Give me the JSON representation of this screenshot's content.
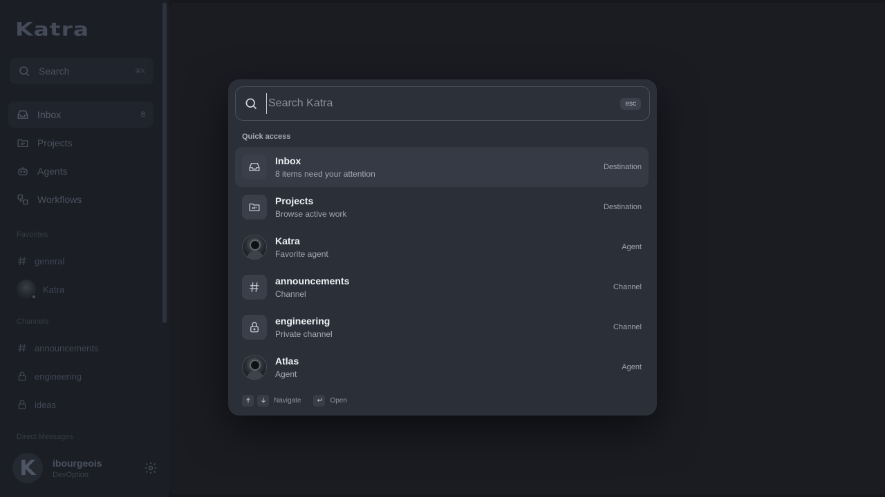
{
  "sidebar": {
    "logo": "Katra",
    "search": {
      "label": "Search",
      "shortcut": "⌘K"
    },
    "nav": [
      {
        "label": "Inbox",
        "icon": "inbox-icon",
        "badge": "8",
        "active": true
      },
      {
        "label": "Projects",
        "icon": "projects-icon"
      },
      {
        "label": "Agents",
        "icon": "agents-icon"
      },
      {
        "label": "Workflows",
        "icon": "workflows-icon"
      }
    ],
    "favorites_title": "Favorites",
    "favorites": [
      {
        "label": "general",
        "icon": "hash-icon"
      },
      {
        "label": "Katra",
        "icon": "avatar"
      }
    ],
    "channels_title": "Channels",
    "channels": [
      {
        "label": "announcements",
        "icon": "hash-icon"
      },
      {
        "label": "engineering",
        "icon": "lock-icon"
      },
      {
        "label": "ideas",
        "icon": "lock-icon"
      }
    ],
    "dm_title": "Direct Messages",
    "user": {
      "initial": "K",
      "name": "ibourgeois",
      "org": "DevOption"
    }
  },
  "palette": {
    "search_placeholder": "Search Katra",
    "esc_label": "esc",
    "section_title": "Quick access",
    "items": [
      {
        "title": "Inbox",
        "subtitle": "8 items need your attention",
        "kind": "Destination",
        "icon": "inbox-icon"
      },
      {
        "title": "Projects",
        "subtitle": "Browse active work",
        "kind": "Destination",
        "icon": "folder-icon"
      },
      {
        "title": "Katra",
        "subtitle": "Favorite agent",
        "kind": "Agent",
        "icon": "agent-avatar"
      },
      {
        "title": "announcements",
        "subtitle": "Channel",
        "kind": "Channel",
        "icon": "hash-icon"
      },
      {
        "title": "engineering",
        "subtitle": "Private channel",
        "kind": "Channel",
        "icon": "lock-icon"
      },
      {
        "title": "Atlas",
        "subtitle": "Agent",
        "kind": "Agent",
        "icon": "agent-avatar"
      }
    ],
    "footer": {
      "navigate_label": "Navigate",
      "open_label": "Open"
    }
  },
  "colors": {
    "background": "#16181d",
    "sidebar": "#1b1e25",
    "palette": "#2b2f38",
    "selected_row": "#353a44"
  }
}
